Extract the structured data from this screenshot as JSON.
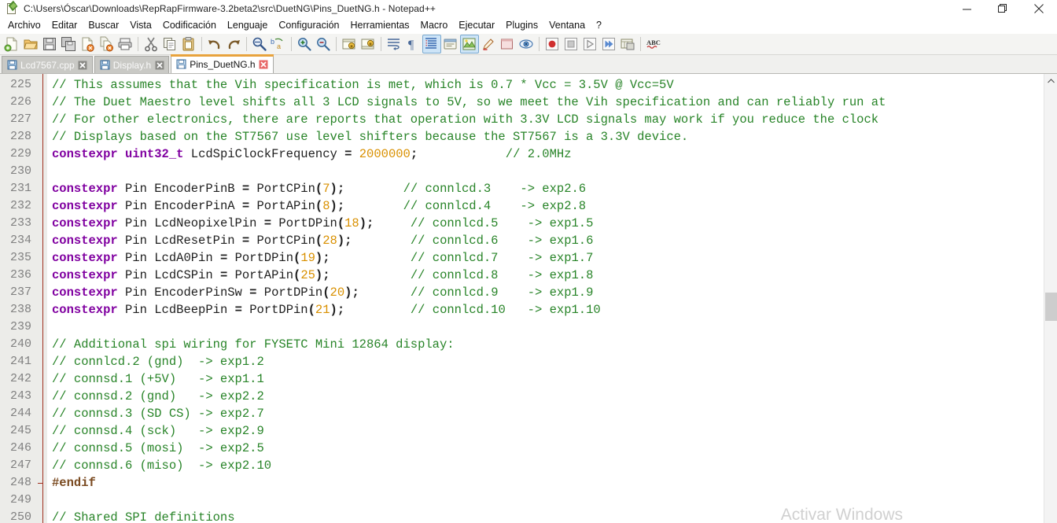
{
  "window": {
    "title": "C:\\Users\\Óscar\\Downloads\\RepRapFirmware-3.2beta2\\src\\DuetNG\\Pins_DuetNG.h - Notepad++",
    "app_icon": "notepadpp-icon",
    "controls": {
      "minimize": "minimize-icon",
      "maximize": "maximize-icon",
      "close": "close-icon"
    }
  },
  "menu": {
    "items": [
      {
        "label": "Archivo"
      },
      {
        "label": "Editar"
      },
      {
        "label": "Buscar"
      },
      {
        "label": "Vista"
      },
      {
        "label": "Codificación"
      },
      {
        "label": "Lenguaje"
      },
      {
        "label": "Configuración"
      },
      {
        "label": "Herramientas"
      },
      {
        "label": "Macro"
      },
      {
        "label": "Ejecutar"
      },
      {
        "label": "Plugins"
      },
      {
        "label": "Ventana"
      },
      {
        "label": "?"
      }
    ]
  },
  "toolbar": {
    "buttons": [
      {
        "name": "new-file-icon",
        "kind": "icon"
      },
      {
        "name": "open-file-icon",
        "kind": "icon"
      },
      {
        "name": "save-icon",
        "kind": "icon"
      },
      {
        "name": "save-all-icon",
        "kind": "icon"
      },
      {
        "name": "close-file-icon",
        "kind": "icon"
      },
      {
        "name": "close-all-files-icon",
        "kind": "icon"
      },
      {
        "name": "print-icon",
        "kind": "icon"
      },
      {
        "name": "separator-1",
        "kind": "sep"
      },
      {
        "name": "cut-icon",
        "kind": "icon"
      },
      {
        "name": "copy-icon",
        "kind": "icon"
      },
      {
        "name": "paste-icon",
        "kind": "icon"
      },
      {
        "name": "separator-2",
        "kind": "sep"
      },
      {
        "name": "undo-icon",
        "kind": "icon"
      },
      {
        "name": "redo-icon",
        "kind": "icon"
      },
      {
        "name": "separator-3",
        "kind": "sep"
      },
      {
        "name": "find-icon",
        "kind": "icon"
      },
      {
        "name": "replace-icon",
        "kind": "icon"
      },
      {
        "name": "separator-4",
        "kind": "sep"
      },
      {
        "name": "zoom-in-icon",
        "kind": "icon"
      },
      {
        "name": "zoom-out-icon",
        "kind": "icon"
      },
      {
        "name": "separator-5",
        "kind": "sep"
      },
      {
        "name": "sync-vertical-scroll-icon",
        "kind": "icon"
      },
      {
        "name": "sync-horizontal-scroll-icon",
        "kind": "icon"
      },
      {
        "name": "separator-6",
        "kind": "sep"
      },
      {
        "name": "word-wrap-icon",
        "kind": "icon"
      },
      {
        "name": "show-all-characters-icon",
        "kind": "icon"
      },
      {
        "name": "show-indent-guide-icon",
        "kind": "icon",
        "active": true
      },
      {
        "name": "user-defined-dialog-icon",
        "kind": "icon"
      },
      {
        "name": "show-whitespace-icon",
        "kind": "icon",
        "active": true
      },
      {
        "name": "highlight-pen-icon",
        "kind": "icon"
      },
      {
        "name": "document-map-icon",
        "kind": "icon"
      },
      {
        "name": "function-list-icon",
        "kind": "icon"
      },
      {
        "name": "separator-7",
        "kind": "sep"
      },
      {
        "name": "record-macro-icon",
        "kind": "icon"
      },
      {
        "name": "stop-macro-icon",
        "kind": "icon"
      },
      {
        "name": "play-macro-icon",
        "kind": "icon"
      },
      {
        "name": "run-macro-multiple-icon",
        "kind": "icon"
      },
      {
        "name": "save-macro-icon",
        "kind": "icon"
      },
      {
        "name": "separator-8",
        "kind": "sep"
      },
      {
        "name": "spell-check-icon",
        "kind": "icon"
      }
    ]
  },
  "tabs": [
    {
      "label": "Lcd7567.cpp",
      "active": false,
      "close": "close-tab-icon"
    },
    {
      "label": "Display.h",
      "active": false,
      "close": "close-tab-icon"
    },
    {
      "label": "Pins_DuetNG.h",
      "active": true,
      "close": "close-tab-icon"
    }
  ],
  "editor": {
    "first_line_number": 225,
    "lines": [
      {
        "n": 225,
        "tokens": [
          {
            "t": "comment",
            "v": "// This assumes that the Vih specification is met, which is 0.7 * Vcc = 3.5V @ Vcc=5V"
          }
        ]
      },
      {
        "n": 226,
        "tokens": [
          {
            "t": "comment",
            "v": "// The Duet Maestro level shifts all 3 LCD signals to 5V, so we meet the Vih specification and can reliably run at"
          }
        ]
      },
      {
        "n": 227,
        "tokens": [
          {
            "t": "comment",
            "v": "// For other electronics, there are reports that operation with 3.3V LCD signals may work if you reduce the clock"
          }
        ]
      },
      {
        "n": 228,
        "tokens": [
          {
            "t": "comment",
            "v": "// Displays based on the ST7567 use level shifters because the ST7567 is a 3.3V device."
          }
        ]
      },
      {
        "n": 229,
        "tokens": [
          {
            "t": "kw",
            "v": "constexpr"
          },
          {
            "t": "plain",
            "v": " "
          },
          {
            "t": "type",
            "v": "uint32_t"
          },
          {
            "t": "plain",
            "v": " "
          },
          {
            "t": "id",
            "v": "LcdSpiClockFrequency"
          },
          {
            "t": "plain",
            "v": " "
          },
          {
            "t": "op",
            "v": "="
          },
          {
            "t": "plain",
            "v": " "
          },
          {
            "t": "num",
            "v": "2000000"
          },
          {
            "t": "punct",
            "v": ";"
          },
          {
            "t": "plain",
            "v": "            "
          },
          {
            "t": "comment",
            "v": "// 2.0MHz"
          }
        ]
      },
      {
        "n": 230,
        "tokens": []
      },
      {
        "n": 231,
        "tokens": [
          {
            "t": "kw",
            "v": "constexpr"
          },
          {
            "t": "plain",
            "v": " "
          },
          {
            "t": "id",
            "v": "Pin EncoderPinB "
          },
          {
            "t": "op",
            "v": "="
          },
          {
            "t": "plain",
            "v": " "
          },
          {
            "t": "id",
            "v": "PortCPin"
          },
          {
            "t": "punct",
            "v": "("
          },
          {
            "t": "num",
            "v": "7"
          },
          {
            "t": "punct",
            "v": ");"
          },
          {
            "t": "plain",
            "v": "        "
          },
          {
            "t": "comment",
            "v": "// connlcd.3    -> exp2.6"
          }
        ]
      },
      {
        "n": 232,
        "tokens": [
          {
            "t": "kw",
            "v": "constexpr"
          },
          {
            "t": "plain",
            "v": " "
          },
          {
            "t": "id",
            "v": "Pin EncoderPinA "
          },
          {
            "t": "op",
            "v": "="
          },
          {
            "t": "plain",
            "v": " "
          },
          {
            "t": "id",
            "v": "PortAPin"
          },
          {
            "t": "punct",
            "v": "("
          },
          {
            "t": "num",
            "v": "8"
          },
          {
            "t": "punct",
            "v": ");"
          },
          {
            "t": "plain",
            "v": "        "
          },
          {
            "t": "comment",
            "v": "// connlcd.4    -> exp2.8"
          }
        ]
      },
      {
        "n": 233,
        "tokens": [
          {
            "t": "kw",
            "v": "constexpr"
          },
          {
            "t": "plain",
            "v": " "
          },
          {
            "t": "id",
            "v": "Pin LcdNeopixelPin "
          },
          {
            "t": "op",
            "v": "="
          },
          {
            "t": "plain",
            "v": " "
          },
          {
            "t": "id",
            "v": "PortDPin"
          },
          {
            "t": "punct",
            "v": "("
          },
          {
            "t": "num",
            "v": "18"
          },
          {
            "t": "punct",
            "v": ");"
          },
          {
            "t": "plain",
            "v": "     "
          },
          {
            "t": "comment",
            "v": "// connlcd.5    -> exp1.5"
          }
        ]
      },
      {
        "n": 234,
        "tokens": [
          {
            "t": "kw",
            "v": "constexpr"
          },
          {
            "t": "plain",
            "v": " "
          },
          {
            "t": "id",
            "v": "Pin LcdResetPin "
          },
          {
            "t": "op",
            "v": "="
          },
          {
            "t": "plain",
            "v": " "
          },
          {
            "t": "id",
            "v": "PortCPin"
          },
          {
            "t": "punct",
            "v": "("
          },
          {
            "t": "num",
            "v": "28"
          },
          {
            "t": "punct",
            "v": ");"
          },
          {
            "t": "plain",
            "v": "        "
          },
          {
            "t": "comment",
            "v": "// connlcd.6    -> exp1.6"
          }
        ]
      },
      {
        "n": 235,
        "tokens": [
          {
            "t": "kw",
            "v": "constexpr"
          },
          {
            "t": "plain",
            "v": " "
          },
          {
            "t": "id",
            "v": "Pin LcdA0Pin "
          },
          {
            "t": "op",
            "v": "="
          },
          {
            "t": "plain",
            "v": " "
          },
          {
            "t": "id",
            "v": "PortDPin"
          },
          {
            "t": "punct",
            "v": "("
          },
          {
            "t": "num",
            "v": "19"
          },
          {
            "t": "punct",
            "v": ");"
          },
          {
            "t": "plain",
            "v": "           "
          },
          {
            "t": "comment",
            "v": "// connlcd.7    -> exp1.7"
          }
        ]
      },
      {
        "n": 236,
        "tokens": [
          {
            "t": "kw",
            "v": "constexpr"
          },
          {
            "t": "plain",
            "v": " "
          },
          {
            "t": "id",
            "v": "Pin LcdCSPin "
          },
          {
            "t": "op",
            "v": "="
          },
          {
            "t": "plain",
            "v": " "
          },
          {
            "t": "id",
            "v": "PortAPin"
          },
          {
            "t": "punct",
            "v": "("
          },
          {
            "t": "num",
            "v": "25"
          },
          {
            "t": "punct",
            "v": ");"
          },
          {
            "t": "plain",
            "v": "           "
          },
          {
            "t": "comment",
            "v": "// connlcd.8    -> exp1.8"
          }
        ]
      },
      {
        "n": 237,
        "tokens": [
          {
            "t": "kw",
            "v": "constexpr"
          },
          {
            "t": "plain",
            "v": " "
          },
          {
            "t": "id",
            "v": "Pin EncoderPinSw "
          },
          {
            "t": "op",
            "v": "="
          },
          {
            "t": "plain",
            "v": " "
          },
          {
            "t": "id",
            "v": "PortDPin"
          },
          {
            "t": "punct",
            "v": "("
          },
          {
            "t": "num",
            "v": "20"
          },
          {
            "t": "punct",
            "v": ");"
          },
          {
            "t": "plain",
            "v": "       "
          },
          {
            "t": "comment",
            "v": "// connlcd.9    -> exp1.9"
          }
        ]
      },
      {
        "n": 238,
        "tokens": [
          {
            "t": "kw",
            "v": "constexpr"
          },
          {
            "t": "plain",
            "v": " "
          },
          {
            "t": "id",
            "v": "Pin LcdBeepPin "
          },
          {
            "t": "op",
            "v": "="
          },
          {
            "t": "plain",
            "v": " "
          },
          {
            "t": "id",
            "v": "PortDPin"
          },
          {
            "t": "punct",
            "v": "("
          },
          {
            "t": "num",
            "v": "21"
          },
          {
            "t": "punct",
            "v": ");"
          },
          {
            "t": "plain",
            "v": "         "
          },
          {
            "t": "comment",
            "v": "// connlcd.10   -> exp1.10"
          }
        ]
      },
      {
        "n": 239,
        "tokens": []
      },
      {
        "n": 240,
        "tokens": [
          {
            "t": "comment",
            "v": "// Additional spi wiring for FYSETC Mini 12864 display:"
          }
        ]
      },
      {
        "n": 241,
        "tokens": [
          {
            "t": "comment",
            "v": "// connlcd.2 (gnd)  -> exp1.2"
          }
        ]
      },
      {
        "n": 242,
        "tokens": [
          {
            "t": "comment",
            "v": "// connsd.1 (+5V)   -> exp1.1"
          }
        ]
      },
      {
        "n": 243,
        "tokens": [
          {
            "t": "comment",
            "v": "// connsd.2 (gnd)   -> exp2.2"
          }
        ]
      },
      {
        "n": 244,
        "tokens": [
          {
            "t": "comment",
            "v": "// connsd.3 (SD CS) -> exp2.7"
          }
        ]
      },
      {
        "n": 245,
        "tokens": [
          {
            "t": "comment",
            "v": "// connsd.4 (sck)   -> exp2.9"
          }
        ]
      },
      {
        "n": 246,
        "tokens": [
          {
            "t": "comment",
            "v": "// connsd.5 (mosi)  -> exp2.5"
          }
        ]
      },
      {
        "n": 247,
        "tokens": [
          {
            "t": "comment",
            "v": "// connsd.6 (miso)  -> exp2.10"
          }
        ]
      },
      {
        "n": 248,
        "tokens": [
          {
            "t": "pre",
            "v": "#endif"
          }
        ],
        "fold_end": true
      },
      {
        "n": 249,
        "tokens": []
      },
      {
        "n": 250,
        "tokens": [
          {
            "t": "comment",
            "v": "// Shared SPI definitions"
          }
        ]
      }
    ]
  },
  "watermark": {
    "line1": "Activar Windows"
  },
  "colors": {
    "comment": "#288428",
    "keyword": "#8000a0",
    "number": "#d99000",
    "identifier": "#202020",
    "preprocessor": "#7a4a20",
    "tab_active_accent": "#e8a33d",
    "gutter_bg": "#ecece9",
    "gutter_fg": "#808080",
    "fold_line": "#a03020",
    "editor_bg": "#ffffff",
    "toolbar_bg": "#f4f4f2"
  }
}
